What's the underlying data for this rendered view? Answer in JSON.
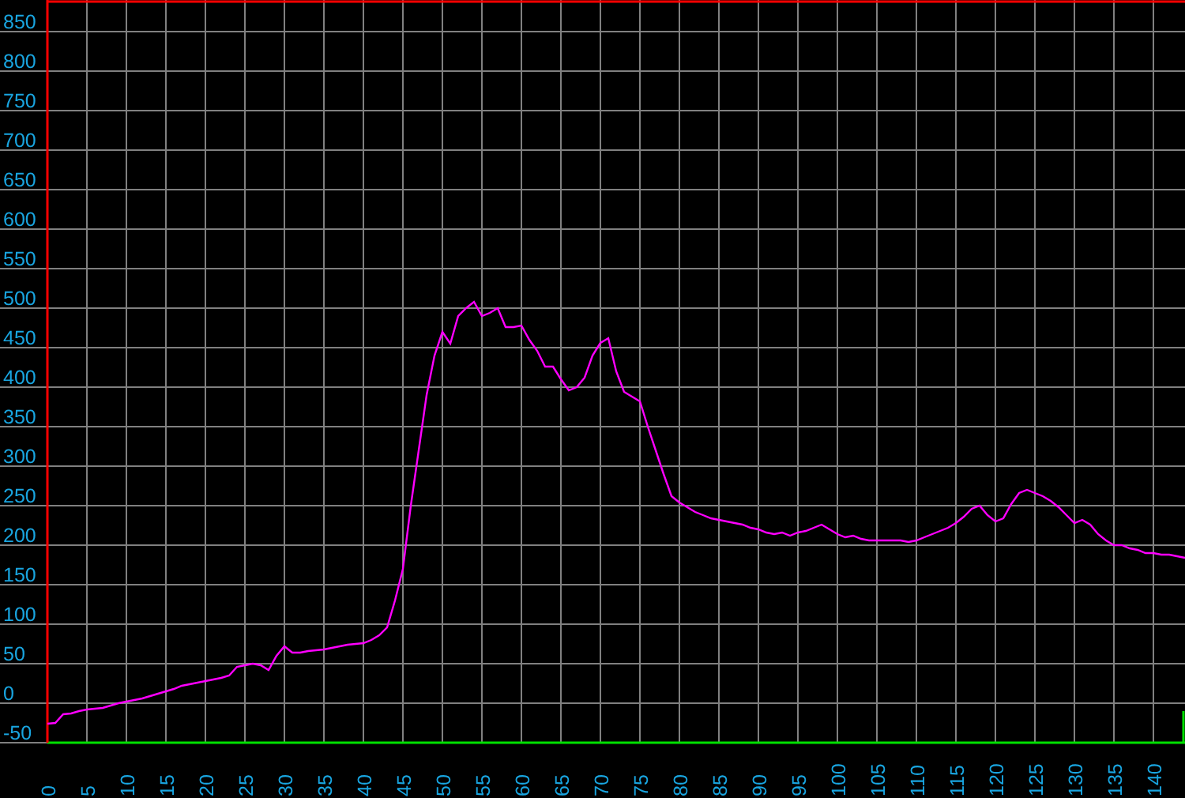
{
  "chart": {
    "chart_data": {
      "type": "line",
      "x": [
        0,
        1,
        2,
        3,
        4,
        5,
        6,
        7,
        8,
        9,
        10,
        11,
        12,
        13,
        14,
        15,
        16,
        17,
        18,
        19,
        20,
        21,
        22,
        23,
        24,
        25,
        26,
        27,
        28,
        29,
        30,
        31,
        32,
        33,
        34,
        35,
        36,
        37,
        38,
        39,
        40,
        41,
        42,
        43,
        44,
        45,
        46,
        47,
        48,
        49,
        50,
        51,
        52,
        53,
        54,
        55,
        56,
        57,
        58,
        59,
        60,
        61,
        62,
        63,
        64,
        65,
        66,
        67,
        68,
        69,
        70,
        71,
        72,
        73,
        74,
        75,
        76,
        77,
        78,
        79,
        80,
        81,
        82,
        83,
        84,
        85,
        86,
        87,
        88,
        89,
        90,
        91,
        92,
        93,
        94,
        95,
        96,
        97,
        98,
        99,
        100,
        101,
        102,
        103,
        104,
        105,
        106,
        107,
        108,
        109,
        110,
        111,
        112,
        113,
        114,
        115,
        116,
        117,
        118,
        119,
        120,
        121,
        122,
        123,
        124,
        125,
        126,
        127,
        128,
        129,
        130,
        131,
        132,
        133,
        134,
        135,
        136,
        137,
        138,
        139,
        140,
        141,
        142,
        143,
        144
      ],
      "series": [
        {
          "color": "#ff00ff",
          "values": [
            -26,
            -25,
            -14,
            -13,
            -10,
            -8,
            -7,
            -6,
            -3,
            0,
            2,
            4,
            6,
            9,
            12,
            15,
            18,
            22,
            24,
            26,
            28,
            30,
            32,
            35,
            46,
            48,
            50,
            48,
            42,
            60,
            72,
            64,
            64,
            66,
            67,
            68,
            70,
            72,
            74,
            75,
            76,
            80,
            86,
            96,
            130,
            170,
            250,
            320,
            390,
            440,
            470,
            455,
            490,
            500,
            508,
            490,
            494,
            500,
            476,
            476,
            478,
            460,
            446,
            426,
            426,
            410,
            396,
            400,
            412,
            440,
            456,
            462,
            420,
            394,
            388,
            382,
            350,
            320,
            290,
            262,
            254,
            248,
            242,
            238,
            234,
            232,
            230,
            228,
            226,
            222,
            220,
            216,
            214,
            216,
            212,
            216,
            218,
            222,
            226,
            220,
            214,
            210,
            212,
            208,
            206,
            206,
            206,
            206,
            206,
            204,
            206,
            210,
            214,
            218,
            222,
            228,
            236,
            246,
            250,
            238,
            230,
            234,
            252,
            266,
            270,
            266,
            262,
            256,
            248,
            238,
            228,
            232,
            226,
            214,
            206,
            200,
            200,
            196,
            194,
            190,
            190,
            188,
            188,
            186,
            184
          ]
        }
      ],
      "grid": true,
      "xlim": [
        0,
        144
      ],
      "ylim": [
        -50,
        890
      ],
      "xticks": [
        0,
        5,
        10,
        15,
        20,
        25,
        30,
        35,
        40,
        45,
        50,
        55,
        60,
        65,
        70,
        75,
        80,
        85,
        90,
        95,
        100,
        105,
        110,
        115,
        120,
        125,
        130,
        135,
        140
      ],
      "yticks": [
        -50,
        0,
        50,
        100,
        150,
        200,
        250,
        300,
        350,
        400,
        450,
        500,
        550,
        600,
        650,
        700,
        750,
        800,
        850
      ]
    }
  }
}
